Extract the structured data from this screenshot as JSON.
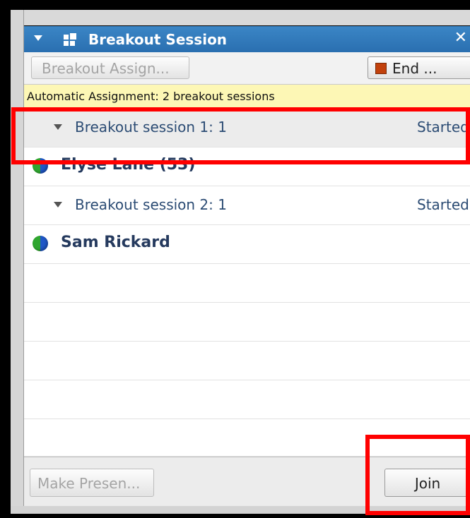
{
  "panel": {
    "title": "Breakout Session",
    "collapse_icon": "triangle-down-icon",
    "panel_icon": "grid-icon",
    "close_icon": "close-icon",
    "title_bar_color": "#2f78ba"
  },
  "toolbar": {
    "assign_label": "Breakout Assign...",
    "end_label": "End ...",
    "end_icon": "stop-icon"
  },
  "banner": {
    "text": "Automatic Assignment: 2 breakout sessions",
    "color": "#fdf7b5"
  },
  "sessions": [
    {
      "label": "Breakout session 1: 1",
      "status": "Started"
    },
    {
      "label": "Breakout session 2: 1",
      "status": "Started"
    }
  ],
  "participants": [
    {
      "name": "Elyse Lane (53)",
      "icon": "globe-status-icon"
    },
    {
      "name": "Sam Rickard",
      "icon": "globe-status-icon"
    }
  ],
  "footer": {
    "present_label": "Make Presen...",
    "join_label": "Join"
  },
  "annotation_color": "#ff0000"
}
